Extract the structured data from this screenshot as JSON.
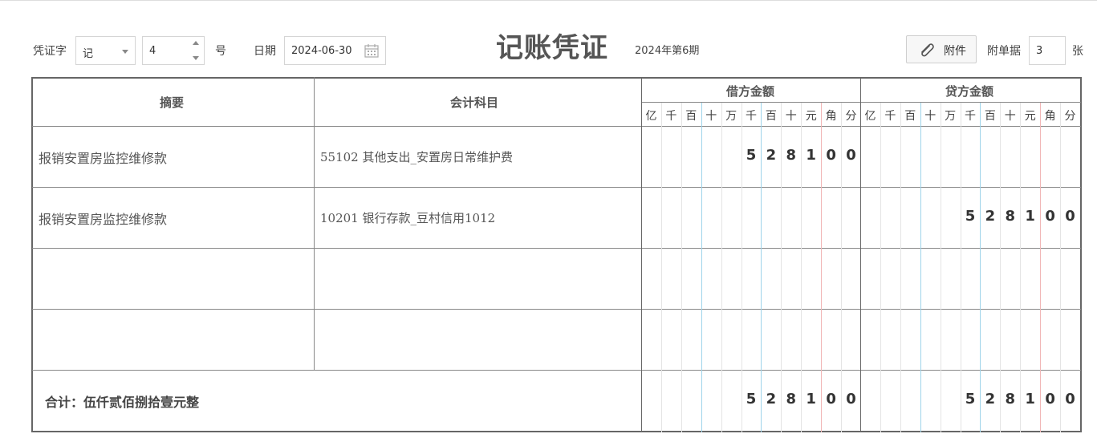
{
  "header": {
    "voucher_word_label": "凭证字",
    "voucher_word_value": "记",
    "voucher_number": "4",
    "number_suffix": "号",
    "date_label": "日期",
    "date_value": "2024-06-30",
    "title": "记账凭证",
    "period": "2024年第6期",
    "attach_button": "附件",
    "attach_count_label": "附单据",
    "attach_count": "3",
    "attach_count_unit": "张"
  },
  "table": {
    "col_summary": "摘要",
    "col_account": "会计科目",
    "col_debit": "借方金额",
    "col_credit": "贷方金额",
    "units": [
      "亿",
      "千",
      "百",
      "十",
      "万",
      "千",
      "百",
      "十",
      "元",
      "角",
      "分"
    ],
    "rows": [
      {
        "summary": "报销安置房监控维修款",
        "account": "55102 其他支出_安置房日常维护费",
        "debit": "528100",
        "credit": ""
      },
      {
        "summary": "报销安置房监控维修款",
        "account": "10201 银行存款_豆村信用1012",
        "debit": "",
        "credit": "528100"
      },
      {
        "summary": "",
        "account": "",
        "debit": "",
        "credit": ""
      },
      {
        "summary": "",
        "account": "",
        "debit": "",
        "credit": ""
      }
    ],
    "total_label": "合计：伍仟贰佰捌拾壹元整",
    "total_debit": "528100",
    "total_credit": "528100"
  },
  "colors": {
    "grid_border": "#666666",
    "unit_separator_blue": "#9fd4ea",
    "decimal_separator_red": "#f1b6b6"
  }
}
